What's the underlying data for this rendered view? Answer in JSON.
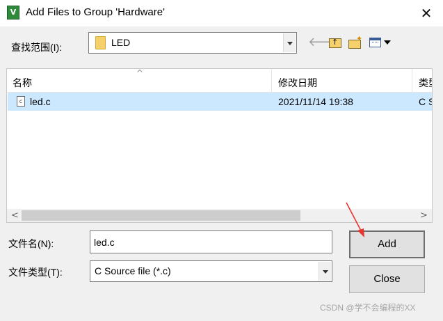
{
  "window": {
    "title": "Add Files to Group 'Hardware'",
    "app_icon_letter": "V",
    "close_glyph": "✕"
  },
  "lookin": {
    "label": "查找范围(I):",
    "value": "LED"
  },
  "toolbar": {
    "back_glyph": "🡐",
    "up_glyph": "↑",
    "new_folder_spark": "✦"
  },
  "filelist": {
    "columns": [
      "名称",
      "修改日期",
      "类型"
    ],
    "sort_glyph": "^",
    "rows": [
      {
        "name": "led.c",
        "modified": "2021/11/14 19:38",
        "type": "C Source file",
        "icon": "c-file-icon"
      }
    ],
    "c_icon_letter": "c"
  },
  "scroll": {
    "left_glyph": "<",
    "right_glyph": ">"
  },
  "filename": {
    "label": "文件名(N):",
    "value": "led.c"
  },
  "filetype": {
    "label": "文件类型(T):",
    "value": "C Source file (*.c)"
  },
  "buttons": {
    "add": "Add",
    "close": "Close"
  },
  "watermark": "CSDN @学不会编程的XX",
  "colors": {
    "selection": "#cce8ff",
    "annotation_arrow": "#e8352f"
  }
}
